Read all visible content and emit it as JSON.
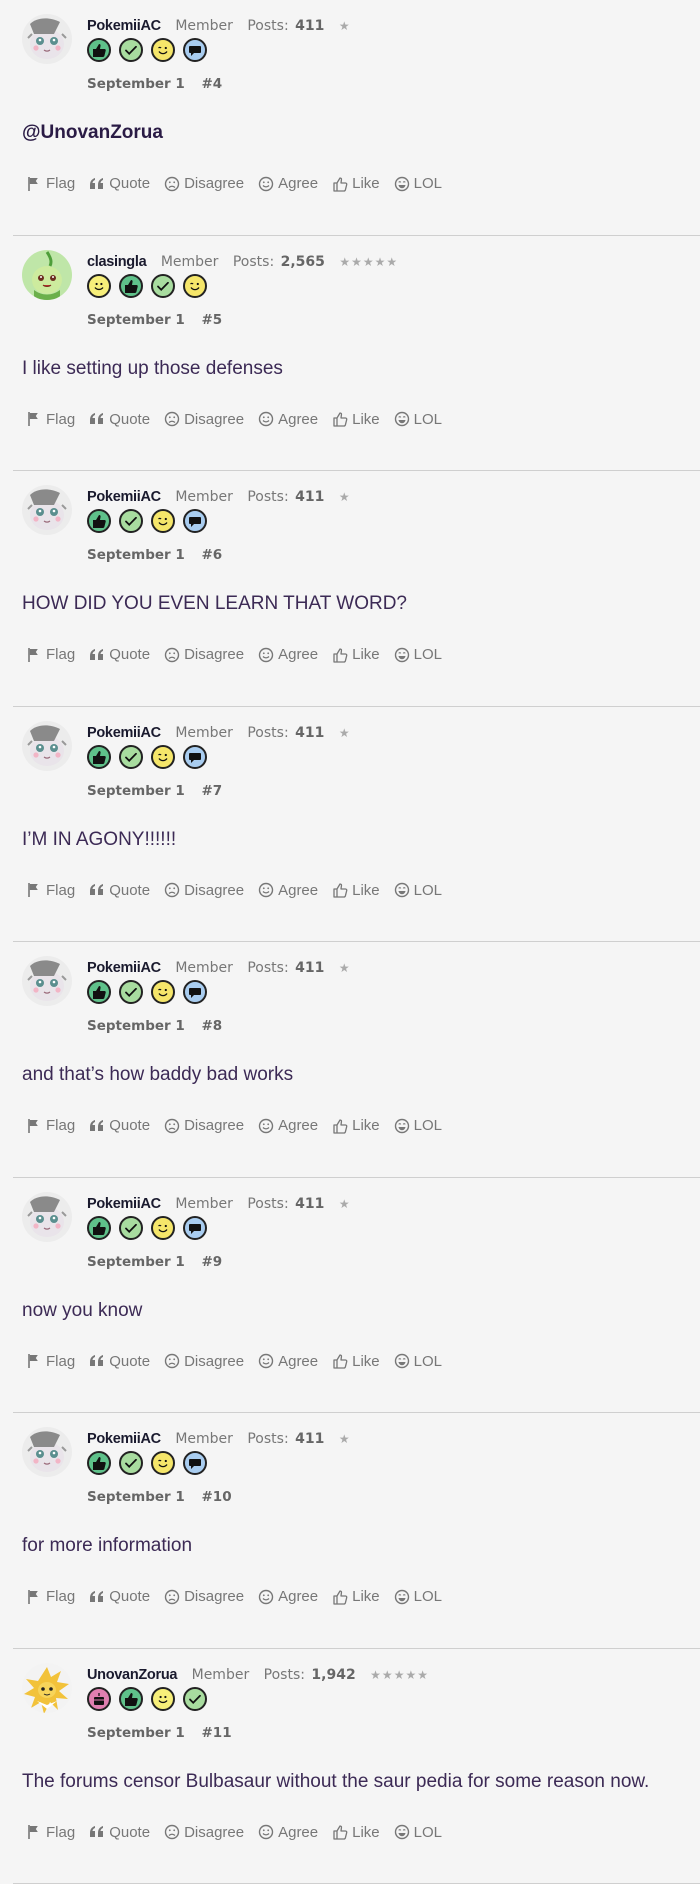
{
  "action_labels": {
    "flag": "Flag",
    "quote": "Quote",
    "disagree": "Disagree",
    "agree": "Agree",
    "like": "Like",
    "lol": "LOL"
  },
  "posts_label": "Posts:",
  "colors": {
    "badge_like": "#5fc18a",
    "badge_check": "#a8dc9f",
    "badge_wink": "#f5e66a",
    "badge_chat": "#a9cdf0",
    "badge_smile": "#f7ef7a",
    "badge_cake": "#e07fb0"
  },
  "posts": [
    {
      "username": "PokemiiAC",
      "role": "Member",
      "post_count": "411",
      "stars": "★",
      "date": "September 1",
      "number": "#4",
      "body": "@UnovanZorua",
      "mention": true,
      "avatar": "pokemiiac-avatar",
      "badges": [
        "like",
        "check",
        "wink",
        "chat"
      ]
    },
    {
      "username": "clasingla",
      "role": "Member",
      "post_count": "2,565",
      "stars": "★★★★★",
      "date": "September 1",
      "number": "#5",
      "body": "I like setting up those defenses",
      "mention": false,
      "avatar": "clasingla-avatar",
      "badges": [
        "smile",
        "like",
        "check",
        "wink"
      ]
    },
    {
      "username": "PokemiiAC",
      "role": "Member",
      "post_count": "411",
      "stars": "★",
      "date": "September 1",
      "number": "#6",
      "body": "HOW DID YOU EVEN LEARN THAT WORD?",
      "mention": false,
      "avatar": "pokemiiac-avatar",
      "badges": [
        "like",
        "check",
        "wink",
        "chat"
      ]
    },
    {
      "username": "PokemiiAC",
      "role": "Member",
      "post_count": "411",
      "stars": "★",
      "date": "September 1",
      "number": "#7",
      "body": "I’M IN AGONY!!!!!!",
      "mention": false,
      "avatar": "pokemiiac-avatar",
      "badges": [
        "like",
        "check",
        "wink",
        "chat"
      ]
    },
    {
      "username": "PokemiiAC",
      "role": "Member",
      "post_count": "411",
      "stars": "★",
      "date": "September 1",
      "number": "#8",
      "body": "and that’s how baddy bad works",
      "mention": false,
      "avatar": "pokemiiac-avatar",
      "badges": [
        "like",
        "check",
        "wink",
        "chat"
      ]
    },
    {
      "username": "PokemiiAC",
      "role": "Member",
      "post_count": "411",
      "stars": "★",
      "date": "September 1",
      "number": "#9",
      "body": "now you know",
      "mention": false,
      "avatar": "pokemiiac-avatar",
      "badges": [
        "like",
        "check",
        "wink",
        "chat"
      ]
    },
    {
      "username": "PokemiiAC",
      "role": "Member",
      "post_count": "411",
      "stars": "★",
      "date": "September 1",
      "number": "#10",
      "body": "for more information",
      "mention": false,
      "avatar": "pokemiiac-avatar",
      "badges": [
        "like",
        "check",
        "wink",
        "chat"
      ]
    },
    {
      "username": "UnovanZorua",
      "role": "Member",
      "post_count": "1,942",
      "stars": "★★★★★",
      "date": "September 1",
      "number": "#11",
      "body": "The forums censor Bulbasaur without the saur pedia for some reason now.",
      "mention": false,
      "avatar": "unovanzorua-avatar",
      "badges": [
        "cake",
        "like",
        "smile",
        "check"
      ]
    }
  ]
}
